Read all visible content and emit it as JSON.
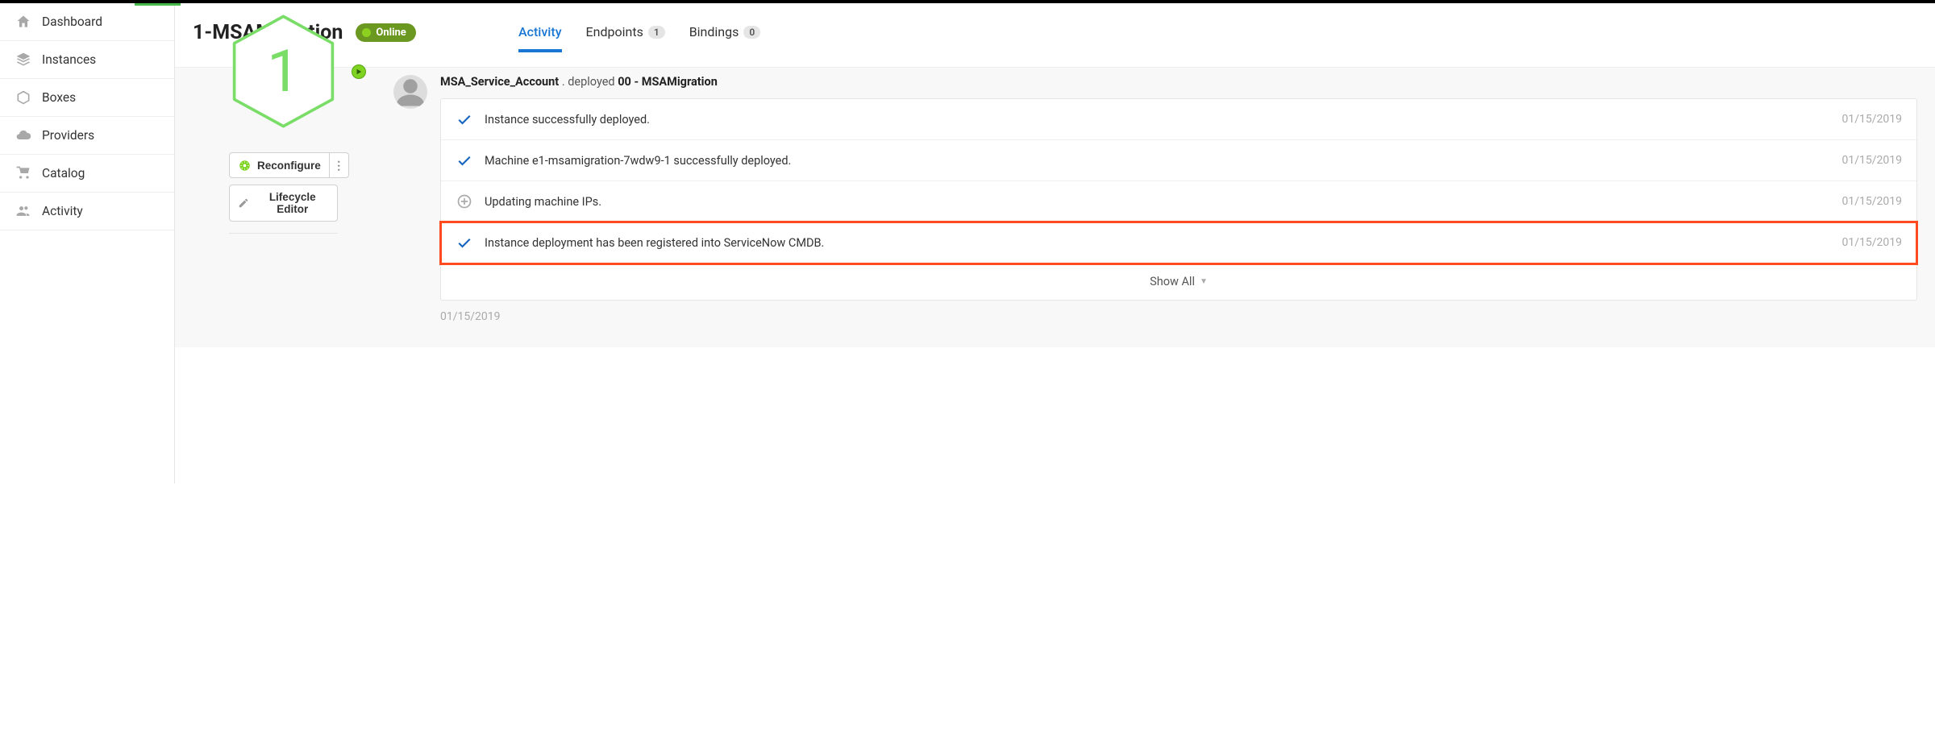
{
  "sidebar": {
    "items": [
      {
        "label": "Dashboard"
      },
      {
        "label": "Instances"
      },
      {
        "label": "Boxes"
      },
      {
        "label": "Providers"
      },
      {
        "label": "Catalog"
      },
      {
        "label": "Activity"
      }
    ]
  },
  "header": {
    "title": "1-MSAMigration",
    "status": "Online"
  },
  "hex": {
    "number": "1"
  },
  "buttons": {
    "reconfigure": "Reconfigure",
    "lifecycle": "Lifecycle Editor"
  },
  "tabs": {
    "activity": "Activity",
    "endpoints": "Endpoints",
    "endpoints_count": "1",
    "bindings": "Bindings",
    "bindings_count": "0"
  },
  "activity": {
    "actor": "MSA_Service_Account",
    "verb": "deployed",
    "target": "00 - MSAMigration",
    "log": [
      {
        "text": "Instance successfully deployed.",
        "date": "01/15/2019",
        "icon": "check"
      },
      {
        "text": "Machine e1-msamigration-7wdw9-1 successfully deployed.",
        "date": "01/15/2019",
        "icon": "check"
      },
      {
        "text": "Updating machine IPs.",
        "date": "01/15/2019",
        "icon": "plus"
      },
      {
        "text": "Instance deployment has been registered into ServiceNow CMDB.",
        "date": "01/15/2019",
        "icon": "check",
        "highlight": true
      }
    ],
    "show_all": "Show All",
    "footer_date": "01/15/2019"
  }
}
